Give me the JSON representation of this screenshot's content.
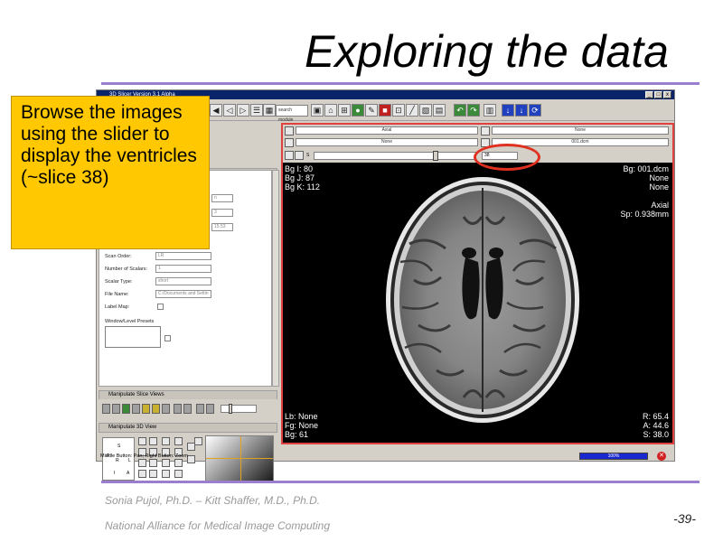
{
  "slide": {
    "title": "Exploring the data",
    "footer_authors": "Sonia Pujol, Ph.D. – Kitt Shaffer, M.D., Ph.D.",
    "footer_org": "National Alliance for Medical Image Computing",
    "page_number": "-39-"
  },
  "callout": {
    "text": "Browse the images using the slider to display the ventricles (~slice 38)"
  },
  "app": {
    "window_title": "3D Slicer Version 3.1 Alpha",
    "window_buttons": [
      "_",
      "□",
      "x"
    ],
    "toolbar": {
      "search_placeholder": "search module"
    },
    "left_panel": {
      "properties": [
        {
          "label": "Scan Order:",
          "value": "LR"
        },
        {
          "label": "Number of Scalars:",
          "value": "1"
        },
        {
          "label": "Scalar Type:",
          "value": "short"
        },
        {
          "label": "File Name:",
          "value": "C:/Documents and Settin"
        },
        {
          "label": "Label Map:",
          "value": ""
        },
        {
          "label": "Window/Level Presets",
          "value": ""
        }
      ],
      "partial_values": [
        "n",
        "3",
        "15.53"
      ],
      "manipulate_slice_views": "Manipulate Slice Views",
      "manipulate_3d_view": "Manipulate 3D View",
      "orientation_letters": [
        "P",
        "S",
        "R",
        "L",
        "I",
        "A"
      ]
    },
    "view": {
      "orientation": "Axial",
      "fg_volume": "None",
      "bg_volume": "001.dcm",
      "slice_number": "38",
      "slice_label": "S"
    },
    "overlay": {
      "top_left": [
        "Bg I: 80",
        "Bg J: 87",
        "Bg K: 112"
      ],
      "top_right": [
        "Bg: 001.dcm",
        "None",
        "None",
        "",
        "Axial",
        "Sp: 0.938mm"
      ],
      "bottom_left": [
        "Lb: None",
        "Fg: None",
        "Bg: 61"
      ],
      "bottom_right": [
        "R: 65.4",
        "A: 44.6",
        "S: 38.0"
      ]
    },
    "status": {
      "message": "Middle Button: Pan; Right Button: Zoom",
      "progress": "100%",
      "progress_fraction": 1.0
    }
  }
}
